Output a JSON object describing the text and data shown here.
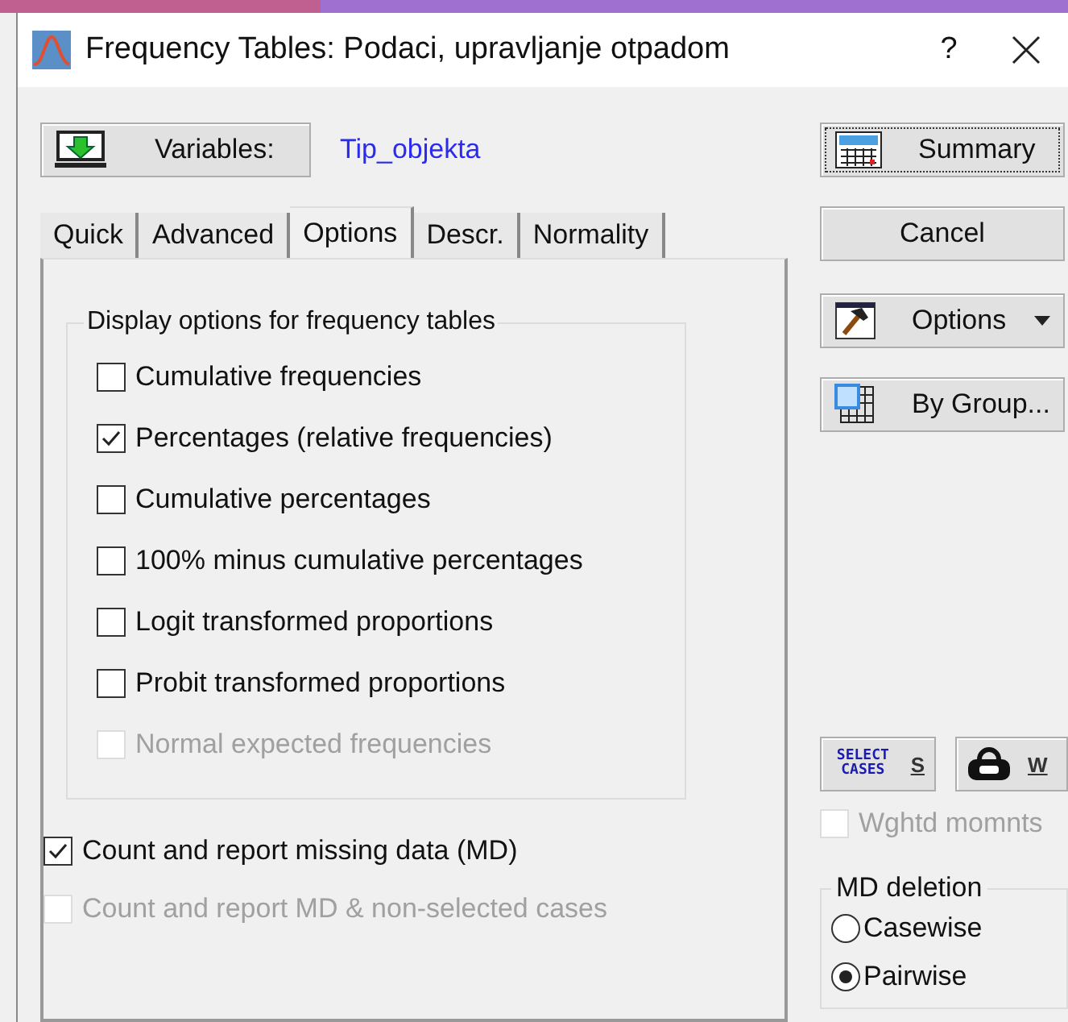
{
  "window": {
    "title": "Frequency Tables: Podaci, upravljanje otpadom",
    "help": "?"
  },
  "variables": {
    "button": "Variables:",
    "value": "Tip_objekta"
  },
  "tabs": [
    {
      "label": "Quick",
      "selected": false
    },
    {
      "label": "Advanced",
      "selected": false
    },
    {
      "label": "Options",
      "selected": true
    },
    {
      "label": "Descr.",
      "selected": false
    },
    {
      "label": "Normality",
      "selected": false
    }
  ],
  "display_options": {
    "title": "Display options for frequency tables",
    "items": [
      {
        "label": "Cumulative frequencies",
        "checked": false,
        "disabled": false
      },
      {
        "label": "Percentages (relative frequencies)",
        "checked": true,
        "disabled": false
      },
      {
        "label": "Cumulative percentages",
        "checked": false,
        "disabled": false
      },
      {
        "label": "100% minus cumulative percentages",
        "checked": false,
        "disabled": false
      },
      {
        "label": "Logit transformed proportions",
        "checked": false,
        "disabled": false
      },
      {
        "label": "Probit transformed proportions",
        "checked": false,
        "disabled": false
      },
      {
        "label": "Normal expected frequencies",
        "checked": false,
        "disabled": true
      }
    ]
  },
  "missing_data": [
    {
      "label": "Count and report missing data (MD)",
      "checked": true,
      "disabled": false
    },
    {
      "label": "Count and report MD & non-selected cases",
      "checked": false,
      "disabled": true
    }
  ],
  "side_buttons": [
    {
      "kind": "summary",
      "label": "Summary",
      "focused": true
    },
    {
      "kind": "plain",
      "label": "Cancel",
      "focused": false
    },
    {
      "kind": "options",
      "label": "Options",
      "focused": false
    },
    {
      "kind": "bygroup",
      "label": "By Group...",
      "focused": false
    }
  ],
  "select_cases": {
    "icon_text": "SELECT CASES",
    "label": "S"
  },
  "weight": {
    "label": "W"
  },
  "weighted_moments": {
    "label": "Wghtd momnts",
    "checked": false,
    "disabled": true
  },
  "md_deletion": {
    "title": "MD deletion",
    "options": [
      {
        "label": "Casewise",
        "selected": false
      },
      {
        "label": "Pairwise",
        "selected": true
      }
    ]
  }
}
